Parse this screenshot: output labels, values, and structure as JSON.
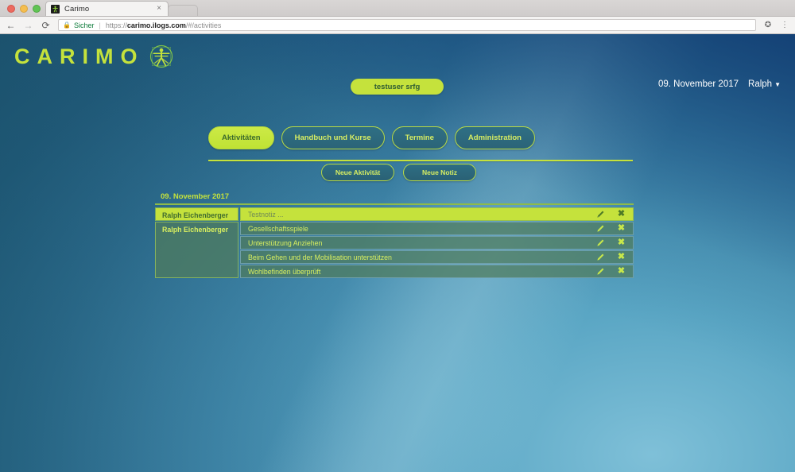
{
  "browser": {
    "tab": {
      "title": "Carimo",
      "close_label": "×",
      "favicon": "carimo-favicon"
    },
    "nav": {
      "back": "←",
      "forward": "→",
      "reload": "⟳"
    },
    "omnibox": {
      "lock_icon": "lock-icon",
      "secure_label": "Sicher",
      "divider": "|",
      "url_scheme": "https://",
      "url_host": "carimo.ilogs.com",
      "url_path": "/#/activities"
    },
    "star_icon": "✪",
    "menu_icon": "⋮",
    "traffic_lights": [
      "close",
      "minimize",
      "zoom"
    ]
  },
  "app": {
    "logo_text": "CARIMO",
    "logo_mark": "vitruvian-man-icon",
    "user_pill": "testuser srfg",
    "date": "09. November 2017",
    "user_name": "Ralph",
    "user_caret": "▼",
    "colors": {
      "accent_green": "#c5e23c",
      "tab_blue": "#2f6f84",
      "row_green": "#4f7b5c",
      "header_blue": "#1b4a80"
    }
  },
  "nav_tabs": [
    {
      "label": "Aktivitäten",
      "active": true
    },
    {
      "label": "Handbuch und Kurse",
      "active": false
    },
    {
      "label": "Termine",
      "active": false
    },
    {
      "label": "Administration",
      "active": false
    }
  ],
  "actions": [
    {
      "label": "Neue Aktivität"
    },
    {
      "label": "Neue Notiz"
    }
  ],
  "activities": {
    "day_header": "09. November 2017",
    "name_cells": [
      {
        "label": "Ralph Eichenberger",
        "highlight": true
      },
      {
        "label": "Ralph Eichenberger",
        "highlight": false
      }
    ],
    "rows": [
      {
        "text": "Testnotiz ...",
        "highlight": true,
        "edit_icon": "pencil-icon",
        "delete_icon": "close-icon"
      },
      {
        "text": "Gesellschaftsspiele",
        "highlight": false,
        "edit_icon": "pencil-icon",
        "delete_icon": "close-icon"
      },
      {
        "text": "Unterstützung Anziehen",
        "highlight": false,
        "edit_icon": "pencil-icon",
        "delete_icon": "close-icon"
      },
      {
        "text": "Beim Gehen und der Mobilisation unterstützen",
        "highlight": false,
        "edit_icon": "pencil-icon",
        "delete_icon": "close-icon"
      },
      {
        "text": "Wohlbefinden überprüft",
        "highlight": false,
        "edit_icon": "pencil-icon",
        "delete_icon": "close-icon"
      }
    ],
    "delete_glyph": "✖"
  }
}
